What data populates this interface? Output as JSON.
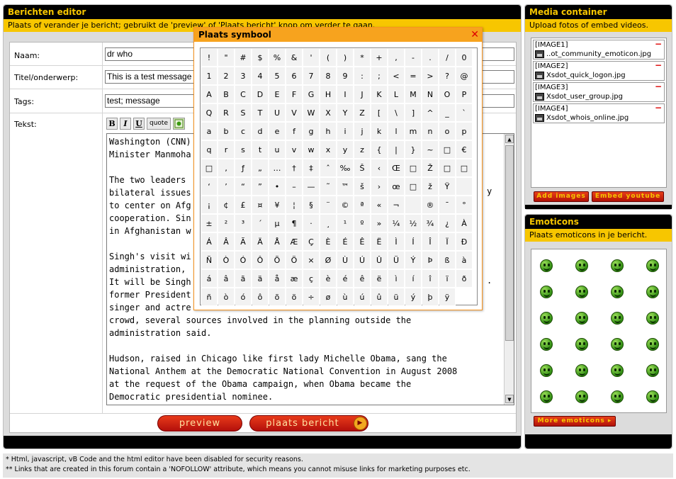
{
  "editor": {
    "title": "Berichten editor",
    "subtitle": "Plaats of verander je bericht; gebruikt de 'preview' of 'Plaats bericht' knop om verder te gaan.",
    "fields": {
      "name_label": "Naam:",
      "name_value": "dr who",
      "title_label": "Titel/onderwerp:",
      "title_value": "This is a test message",
      "tags_label": "Tags:",
      "tags_value": "test; message",
      "text_label": "Tekst:"
    },
    "toolbar": {
      "bold": "B",
      "italic": "I",
      "underline": "U",
      "quote": "quote"
    },
    "text_lines": [
      "Washington (CNN)",
      "Minister Manmoha",
      "",
      "The two leaders",
      "bilateral issues",
      "to center on Afg",
      "cooperation. Sin",
      "in Afghanistan w",
      "",
      "Singh's visit wi",
      "administration,",
      "It will be Singh",
      "former President",
      "singer and actre",
      "crowd, several sources involved in the planning outside the",
      "administration said.",
      "",
      "Hudson, raised in Chicago like first lady Michelle Obama, sang the",
      "National Anthem at the Democratic National Convention in August 2008",
      "at the request of the Obama campaign, when Obama became the",
      "Democratic presidential nominee."
    ],
    "text_right_fragments": {
      "y": "y",
      "dot": "."
    },
    "buttons": {
      "preview": "preview",
      "submit": "plaats bericht"
    }
  },
  "media": {
    "title": "Media container",
    "subtitle": "Upload fotos of embed videos.",
    "items": [
      {
        "tag": "[IMAGE1]",
        "file": "..ot_community_emoticon.jpg"
      },
      {
        "tag": "[IMAGE2]",
        "file": "Xsdot_quick_logon.jpg"
      },
      {
        "tag": "[IMAGE3]",
        "file": "Xsdot_user_group.jpg"
      },
      {
        "tag": "[IMAGE4]",
        "file": "Xsdot_whois_online.jpg"
      }
    ],
    "remove_glyph": "−",
    "add_images": "Add images",
    "embed_youtube": "Embed youtube"
  },
  "emoticons": {
    "title": "Emoticons",
    "subtitle": "Plaats emoticons in je bericht.",
    "more": "More emoticons",
    "count": 24
  },
  "symbol_popup": {
    "title": "Plaats symbool",
    "close": "✕",
    "symbols": [
      "!",
      "\"",
      "#",
      "$",
      "%",
      "&",
      "'",
      "(",
      ")",
      "*",
      "+",
      ",",
      "-",
      ".",
      "/",
      "0",
      "1",
      "2",
      "3",
      "4",
      "5",
      "6",
      "7",
      "8",
      "9",
      ":",
      ";",
      "<",
      "=",
      ">",
      "?",
      "@",
      "A",
      "B",
      "C",
      "D",
      "E",
      "F",
      "G",
      "H",
      "I",
      "J",
      "K",
      "L",
      "M",
      "N",
      "O",
      "P",
      "Q",
      "R",
      "S",
      "T",
      "U",
      "V",
      "W",
      "X",
      "Y",
      "Z",
      "[",
      "\\",
      "]",
      "^",
      "_",
      "`",
      "a",
      "b",
      "c",
      "d",
      "e",
      "f",
      "g",
      "h",
      "i",
      "j",
      "k",
      "l",
      "m",
      "n",
      "o",
      "p",
      "q",
      "r",
      "s",
      "t",
      "u",
      "v",
      "w",
      "x",
      "y",
      "z",
      "{",
      "|",
      "}",
      "~",
      "□",
      "€",
      "□",
      "‚",
      "ƒ",
      "„",
      "…",
      "†",
      "‡",
      "ˆ",
      "‰",
      "Š",
      "‹",
      "Œ",
      "□",
      "Ž",
      "□",
      "□",
      "‘",
      "’",
      "“",
      "”",
      "•",
      "–",
      "—",
      "˜",
      "™",
      "š",
      "›",
      "œ",
      "□",
      "ž",
      "Ÿ",
      " ",
      "¡",
      "¢",
      "£",
      "¤",
      "¥",
      "¦",
      "§",
      "¨",
      "©",
      "ª",
      "«",
      "¬",
      "",
      "®",
      "¯",
      "°",
      "±",
      "²",
      "³",
      "´",
      "µ",
      "¶",
      "·",
      "¸",
      "¹",
      "º",
      "»",
      "¼",
      "½",
      "¾",
      "¿",
      "À",
      "Á",
      "Â",
      "Ã",
      "Ä",
      "Å",
      "Æ",
      "Ç",
      "È",
      "É",
      "Ê",
      "Ë",
      "Ì",
      "Í",
      "Î",
      "Ï",
      "Ð",
      "Ñ",
      "Ò",
      "Ó",
      "Ô",
      "Õ",
      "Ö",
      "×",
      "Ø",
      "Ù",
      "Ú",
      "Û",
      "Ü",
      "Ý",
      "Þ",
      "ß",
      "à",
      "á",
      "â",
      "ã",
      "ä",
      "å",
      "æ",
      "ç",
      "è",
      "é",
      "ê",
      "ë",
      "ì",
      "í",
      "î",
      "ï",
      "ð",
      "ñ",
      "ò",
      "ó",
      "ô",
      "õ",
      "ö",
      "÷",
      "ø",
      "ù",
      "ú",
      "û",
      "ü",
      "ý",
      "þ",
      "ÿ"
    ]
  },
  "notes": {
    "line1": "* Html, javascript, vB Code and the html editor have been disabled for security reasons.",
    "line2": "** Links that are created in this forum contain a 'NOFOLLOW' attribute, which means you cannot misuse links for marketing purposes etc."
  }
}
